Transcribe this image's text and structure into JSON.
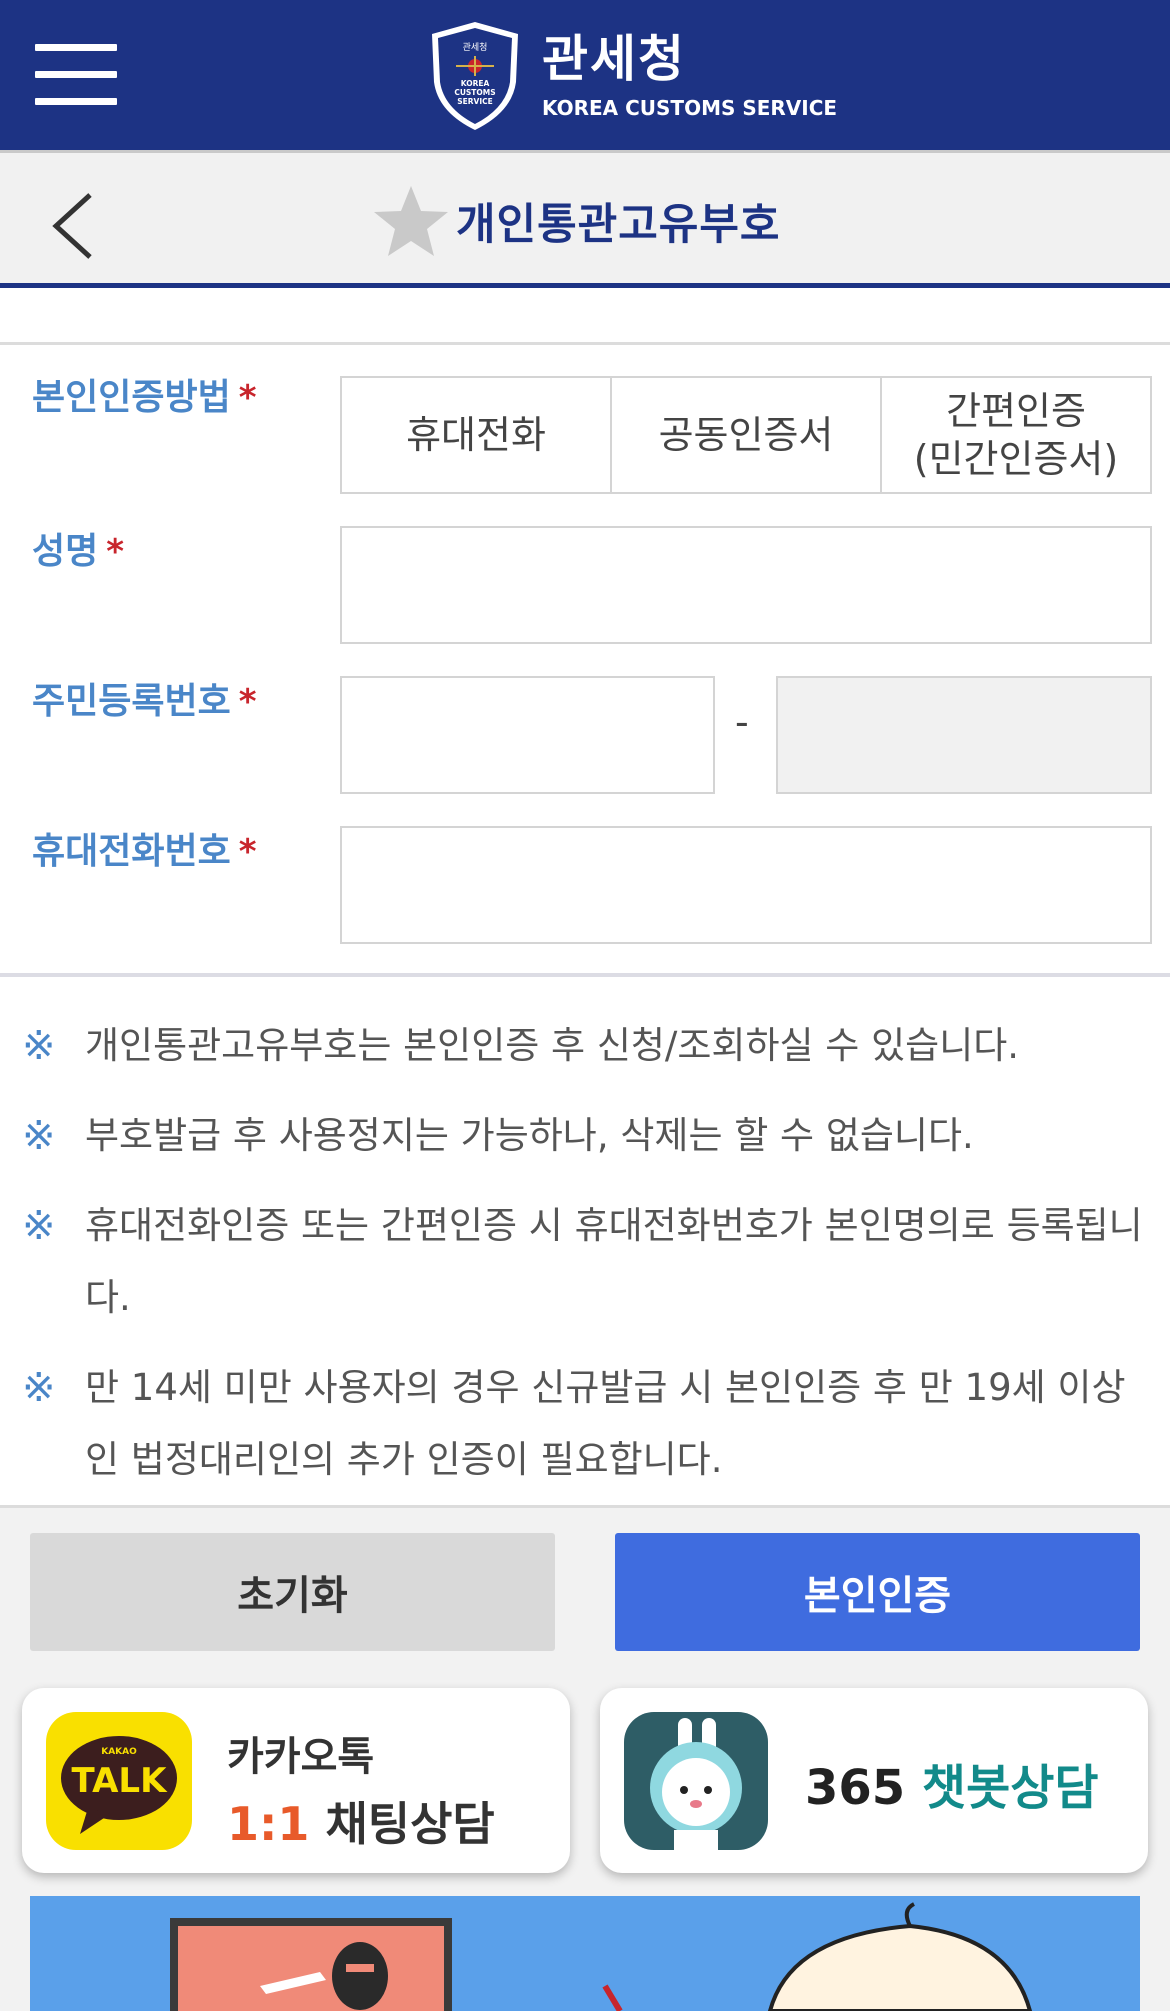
{
  "header": {
    "logo_ko": "관세청",
    "logo_en": "KOREA CUSTOMS SERVICE",
    "emblem_top_text": "관세청",
    "emblem_text_1": "KOREA",
    "emblem_text_2": "CUSTOMS",
    "emblem_text_3": "SERVICE"
  },
  "titlebar": {
    "title": "개인통관고유부호"
  },
  "form": {
    "auth_method_label": "본인인증방법",
    "required_mark": "*",
    "auth_options": [
      "휴대전화",
      "공동인증서",
      "간편인증\n(민간인증서)"
    ],
    "name_label": "성명",
    "name_value": "",
    "rrn_label": "주민등록번호",
    "rrn_front_value": "",
    "rrn_separator": "-",
    "rrn_back_value": "",
    "phone_label": "휴대전화번호",
    "phone_value": ""
  },
  "notes": {
    "mark": "※",
    "items": [
      "개인통관고유부호는 본인인증 후 신청/조회하실 수 있습니다.",
      "부호발급 후 사용정지는 가능하나, 삭제는 할 수 없습니다.",
      "휴대전화인증 또는 간편인증 시 휴대전화번호가 본인명의로 등록됩니다.",
      "만 14세 미만 사용자의 경우 신규발급 시 본인인증 후 만 19세 이상인 법정대리인의 추가 인증이 필요합니다."
    ]
  },
  "buttons": {
    "reset": "초기화",
    "auth": "본인인증"
  },
  "kakao": {
    "icon_label": "TALK",
    "icon_small": "KAKAO",
    "title": "카카오톡",
    "sub_num": "1:1",
    "sub_text": "채팅상담"
  },
  "chatbot": {
    "num": "365",
    "text_teal": "챗봇",
    "text_dark": "상담"
  },
  "colors": {
    "header_bg": "#1d3384",
    "label_blue": "#4a86c8",
    "required_red": "#c8252c",
    "auth_button": "#3f6cdf",
    "reset_button": "#d9d9d9"
  }
}
